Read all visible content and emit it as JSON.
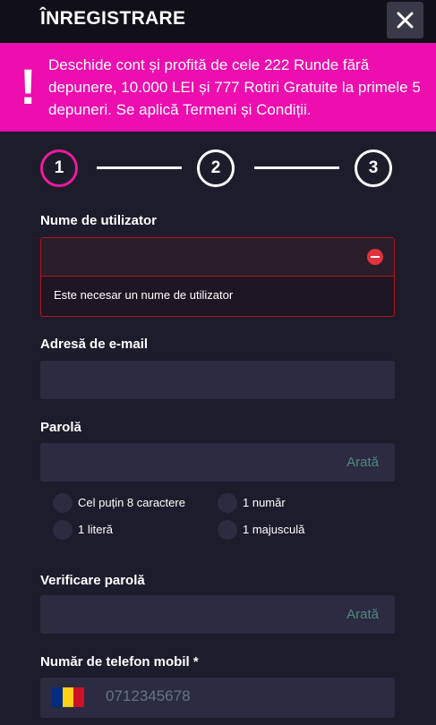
{
  "header": {
    "title": "ÎNREGISTRARE",
    "close_icon": "close-icon"
  },
  "promo": {
    "icon": "!",
    "text": "Deschide cont și profită de cele 222 Runde fără depunere, 10.000 LEI și 777 Rotiri Gratuite la primele 5 depuneri. Se aplică Termeni și Condiții.",
    "background": "#ee0dae"
  },
  "steps": [
    "1",
    "2",
    "3"
  ],
  "form": {
    "username": {
      "label": "Nume de utilizator",
      "value": "",
      "error": "Este necesar un nume de utilizator"
    },
    "email": {
      "label": "Adresă de e-mail",
      "value": ""
    },
    "password": {
      "label": "Parolă",
      "value": "",
      "show_label": "Arată",
      "requirements": [
        "Cel puțin 8 caractere",
        "1 număr",
        "1 literă",
        "1 majusculă"
      ]
    },
    "confirm_password": {
      "label": "Verificare parolă",
      "value": "",
      "show_label": "Arată"
    },
    "phone": {
      "label": "Număr de telefon mobil *",
      "placeholder": "0712345678",
      "flag_colors": [
        "#002b7f",
        "#fcd116",
        "#ce1126"
      ]
    }
  },
  "colors": {
    "accent": "#ee1a9c",
    "error": "#b3121e",
    "background": "#1d1c2b"
  }
}
